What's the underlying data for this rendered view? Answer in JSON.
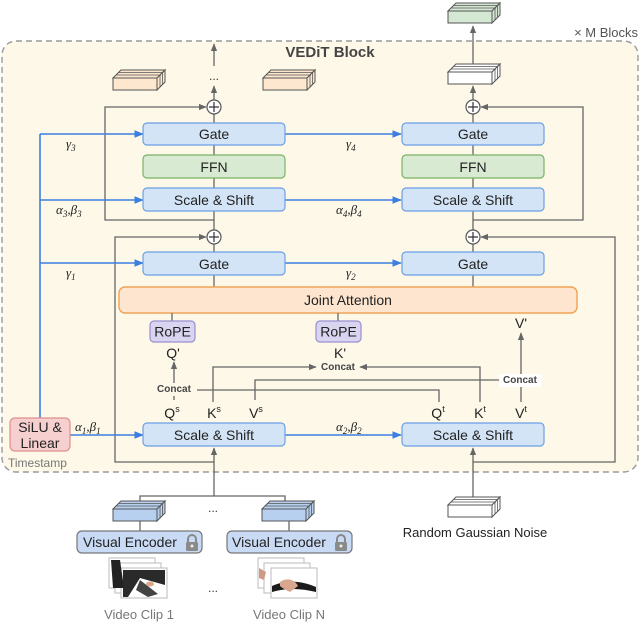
{
  "diagram": {
    "title": "VEDiT Block",
    "repeat_label": "× M Blocks",
    "colors": {
      "block_background": "#fdf8e8",
      "block_border": "#999999",
      "blue_box_fill": "#d3e4f6",
      "blue_box_border": "#6c9fe6",
      "green_box_fill": "#d9ead3",
      "green_box_border": "#79b366",
      "orange_box_fill": "#fde5cf",
      "orange_box_border": "#f0a356",
      "purple_box_fill": "#d9d4f0",
      "purple_box_border": "#9a8fd0",
      "red_box_fill": "#f6cfcf",
      "red_box_border": "#e08f8f",
      "blue_arrow": "#3d7fe0",
      "gray_arrow": "#666666",
      "output_tensor_fill": "#d5e8d4",
      "clip_tensor_fill": "#b8d0ef",
      "intermediate_tensor_fill": "#fde8cf"
    },
    "left_column": {
      "gate_top": "Gate",
      "ffn": "FFN",
      "scale_shift_top": "Scale & Shift",
      "gate_bottom": "Gate",
      "scale_shift_bottom": "Scale & Shift"
    },
    "right_column": {
      "gate_top": "Gate",
      "ffn": "FFN",
      "scale_shift_top": "Scale & Shift",
      "gate_bottom": "Gate",
      "scale_shift_bottom": "Scale & Shift"
    },
    "joint_attention": "Joint Attention",
    "rope": [
      "RoPE",
      "RoPE"
    ],
    "attention_inputs": {
      "q_prime": "Q'",
      "k_prime": "K'",
      "v_prime": "V'"
    },
    "concat_label": "Concat",
    "source_tokens": [
      "Q",
      "K",
      "V"
    ],
    "source_sup": "s",
    "target_tokens": [
      "Q",
      "K",
      "V"
    ],
    "target_sup": "t",
    "modulation": {
      "gamma3": {
        "sym": "γ",
        "sub": "3"
      },
      "gamma4": {
        "sym": "γ",
        "sub": "4"
      },
      "alpha3beta3": {
        "a": "α",
        "b": "β",
        "sub": "3"
      },
      "alpha4beta4": {
        "a": "α",
        "b": "β",
        "sub": "4"
      },
      "gamma1": {
        "sym": "γ",
        "sub": "1"
      },
      "gamma2": {
        "sym": "γ",
        "sub": "2"
      },
      "alpha1beta1": {
        "a": "α",
        "b": "β",
        "sub": "1"
      },
      "alpha2beta2": {
        "a": "α",
        "b": "β",
        "sub": "2"
      }
    },
    "timestep_module": {
      "line1": "SiLU &",
      "line2": "Linear",
      "caption": "Timestamp"
    },
    "ellipsis": "...",
    "encoders": [
      {
        "label": "Visual Encoder",
        "icon": "lock-icon",
        "clip": "Video Clip 1"
      },
      {
        "label": "Visual Encoder",
        "icon": "lock-icon",
        "clip": "Video Clip N"
      }
    ],
    "noise_label": "Random Gaussian Noise"
  }
}
